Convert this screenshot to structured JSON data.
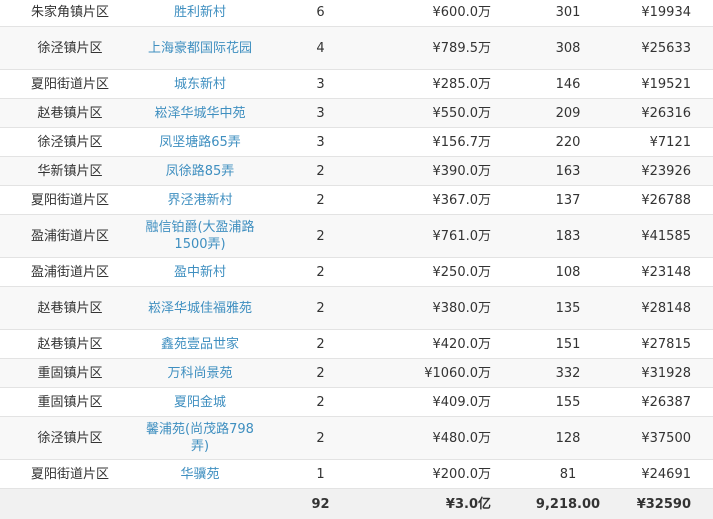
{
  "rows": [
    {
      "district": "朱家角镇片区",
      "name": "胜利新村",
      "count": "6",
      "total": "¥600.0万",
      "area": "301",
      "unit_price": "¥19934"
    },
    {
      "district": "徐泾镇片区",
      "name": "上海豪都国际花园",
      "count": "4",
      "total": "¥789.5万",
      "area": "308",
      "unit_price": "¥25633"
    },
    {
      "district": "夏阳街道片区",
      "name": "城东新村",
      "count": "3",
      "total": "¥285.0万",
      "area": "146",
      "unit_price": "¥19521"
    },
    {
      "district": "赵巷镇片区",
      "name": "崧泽华城华中苑",
      "count": "3",
      "total": "¥550.0万",
      "area": "209",
      "unit_price": "¥26316"
    },
    {
      "district": "徐泾镇片区",
      "name": "凤坚塘路65弄",
      "count": "3",
      "total": "¥156.7万",
      "area": "220",
      "unit_price": "¥7121"
    },
    {
      "district": "华新镇片区",
      "name": "凤徐路85弄",
      "count": "2",
      "total": "¥390.0万",
      "area": "163",
      "unit_price": "¥23926"
    },
    {
      "district": "夏阳街道片区",
      "name": "界泾港新村",
      "count": "2",
      "total": "¥367.0万",
      "area": "137",
      "unit_price": "¥26788"
    },
    {
      "district": "盈浦街道片区",
      "name": "融信铂爵(大盈浦路1500弄)",
      "count": "2",
      "total": "¥761.0万",
      "area": "183",
      "unit_price": "¥41585"
    },
    {
      "district": "盈浦街道片区",
      "name": "盈中新村",
      "count": "2",
      "total": "¥250.0万",
      "area": "108",
      "unit_price": "¥23148"
    },
    {
      "district": "赵巷镇片区",
      "name": "崧泽华城佳福雅苑",
      "count": "2",
      "total": "¥380.0万",
      "area": "135",
      "unit_price": "¥28148"
    },
    {
      "district": "赵巷镇片区",
      "name": "鑫苑壹品世家",
      "count": "2",
      "total": "¥420.0万",
      "area": "151",
      "unit_price": "¥27815"
    },
    {
      "district": "重固镇片区",
      "name": "万科尚景苑",
      "count": "2",
      "total": "¥1060.0万",
      "area": "332",
      "unit_price": "¥31928"
    },
    {
      "district": "重固镇片区",
      "name": "夏阳金城",
      "count": "2",
      "total": "¥409.0万",
      "area": "155",
      "unit_price": "¥26387"
    },
    {
      "district": "徐泾镇片区",
      "name": "馨浦苑(尚茂路798弄)",
      "count": "2",
      "total": "¥480.0万",
      "area": "128",
      "unit_price": "¥37500"
    },
    {
      "district": "夏阳街道片区",
      "name": "华骥苑",
      "count": "1",
      "total": "¥200.0万",
      "area": "81",
      "unit_price": "¥24691"
    }
  ],
  "totals": {
    "district": "",
    "name": "",
    "count": "92",
    "total": "¥3.0亿",
    "area": "9,218.00",
    "unit_price": "¥32590"
  },
  "colors": {
    "link": "#3f8fc0",
    "text": "#333333",
    "stripe": "#f8f8f8",
    "footer": "#f1f1f1"
  }
}
